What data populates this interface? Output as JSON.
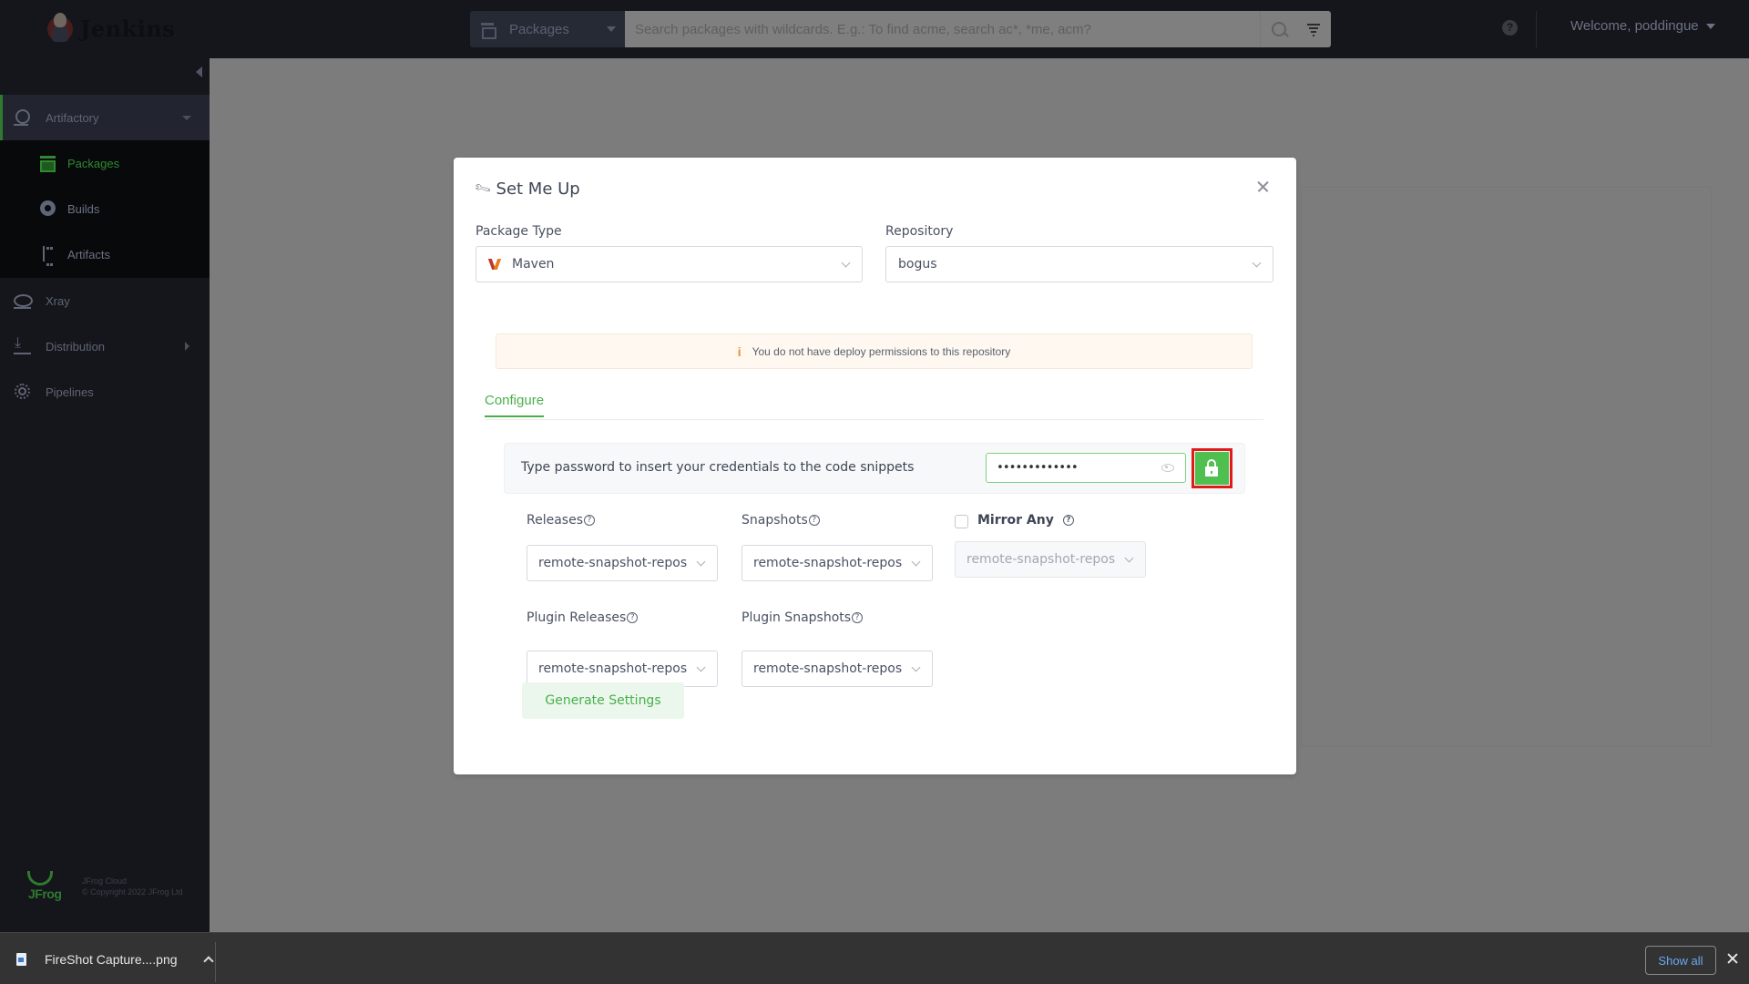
{
  "topbar": {
    "brand": "Jenkins",
    "package_selector": "Packages",
    "search_placeholder": "Search packages with wildcards. E.g.: To find acme, search ac*, *me, acm?",
    "help": "?",
    "welcome": "Welcome, poddingue"
  },
  "sidebar": {
    "items": [
      {
        "label": "Artifactory",
        "icon": "artifactory-icon",
        "active": true,
        "expanded": true
      },
      {
        "label": "Xray",
        "icon": "xray-icon"
      },
      {
        "label": "Distribution",
        "icon": "distribution-icon",
        "has_submenu": true
      },
      {
        "label": "Pipelines",
        "icon": "pipelines-icon"
      }
    ],
    "subitems": [
      {
        "label": "Packages",
        "icon": "packages-icon",
        "active": true
      },
      {
        "label": "Builds",
        "icon": "builds-icon"
      },
      {
        "label": "Artifacts",
        "icon": "artifacts-icon"
      }
    ],
    "footer": {
      "logo": "JFrog",
      "line1": "JFrog Cloud",
      "line2": "© Copyright 2022 JFrog Ltd"
    }
  },
  "modal": {
    "title": "Set Me Up",
    "package_type_label": "Package Type",
    "package_type_value": "Maven",
    "repository_label": "Repository",
    "repository_value": "bogus",
    "warning": "You do not have deploy permissions to this repository",
    "tabs": [
      "Configure"
    ],
    "credentials_text": "Type password to insert your credentials to the code snippets",
    "password_value": "•••••••••••••",
    "fields": {
      "releases": {
        "label": "Releases",
        "value": "remote-snapshot-repos"
      },
      "snapshots": {
        "label": "Snapshots",
        "value": "remote-snapshot-repos"
      },
      "mirror_any": {
        "label": "Mirror Any",
        "checked": false,
        "value": "remote-snapshot-repos"
      },
      "plugin_releases": {
        "label": "Plugin Releases",
        "value": "remote-snapshot-repos"
      },
      "plugin_snapshots": {
        "label": "Plugin Snapshots",
        "value": "remote-snapshot-repos"
      }
    },
    "generate_button": "Generate Settings"
  },
  "download_bar": {
    "file_name": "FireShot Capture....png",
    "show_all": "Show all"
  },
  "colors": {
    "accent_green": "#49b049",
    "highlight_red": "#e11a1a",
    "warning_bg": "#fef8f0",
    "warning_icon": "#e8922a"
  }
}
